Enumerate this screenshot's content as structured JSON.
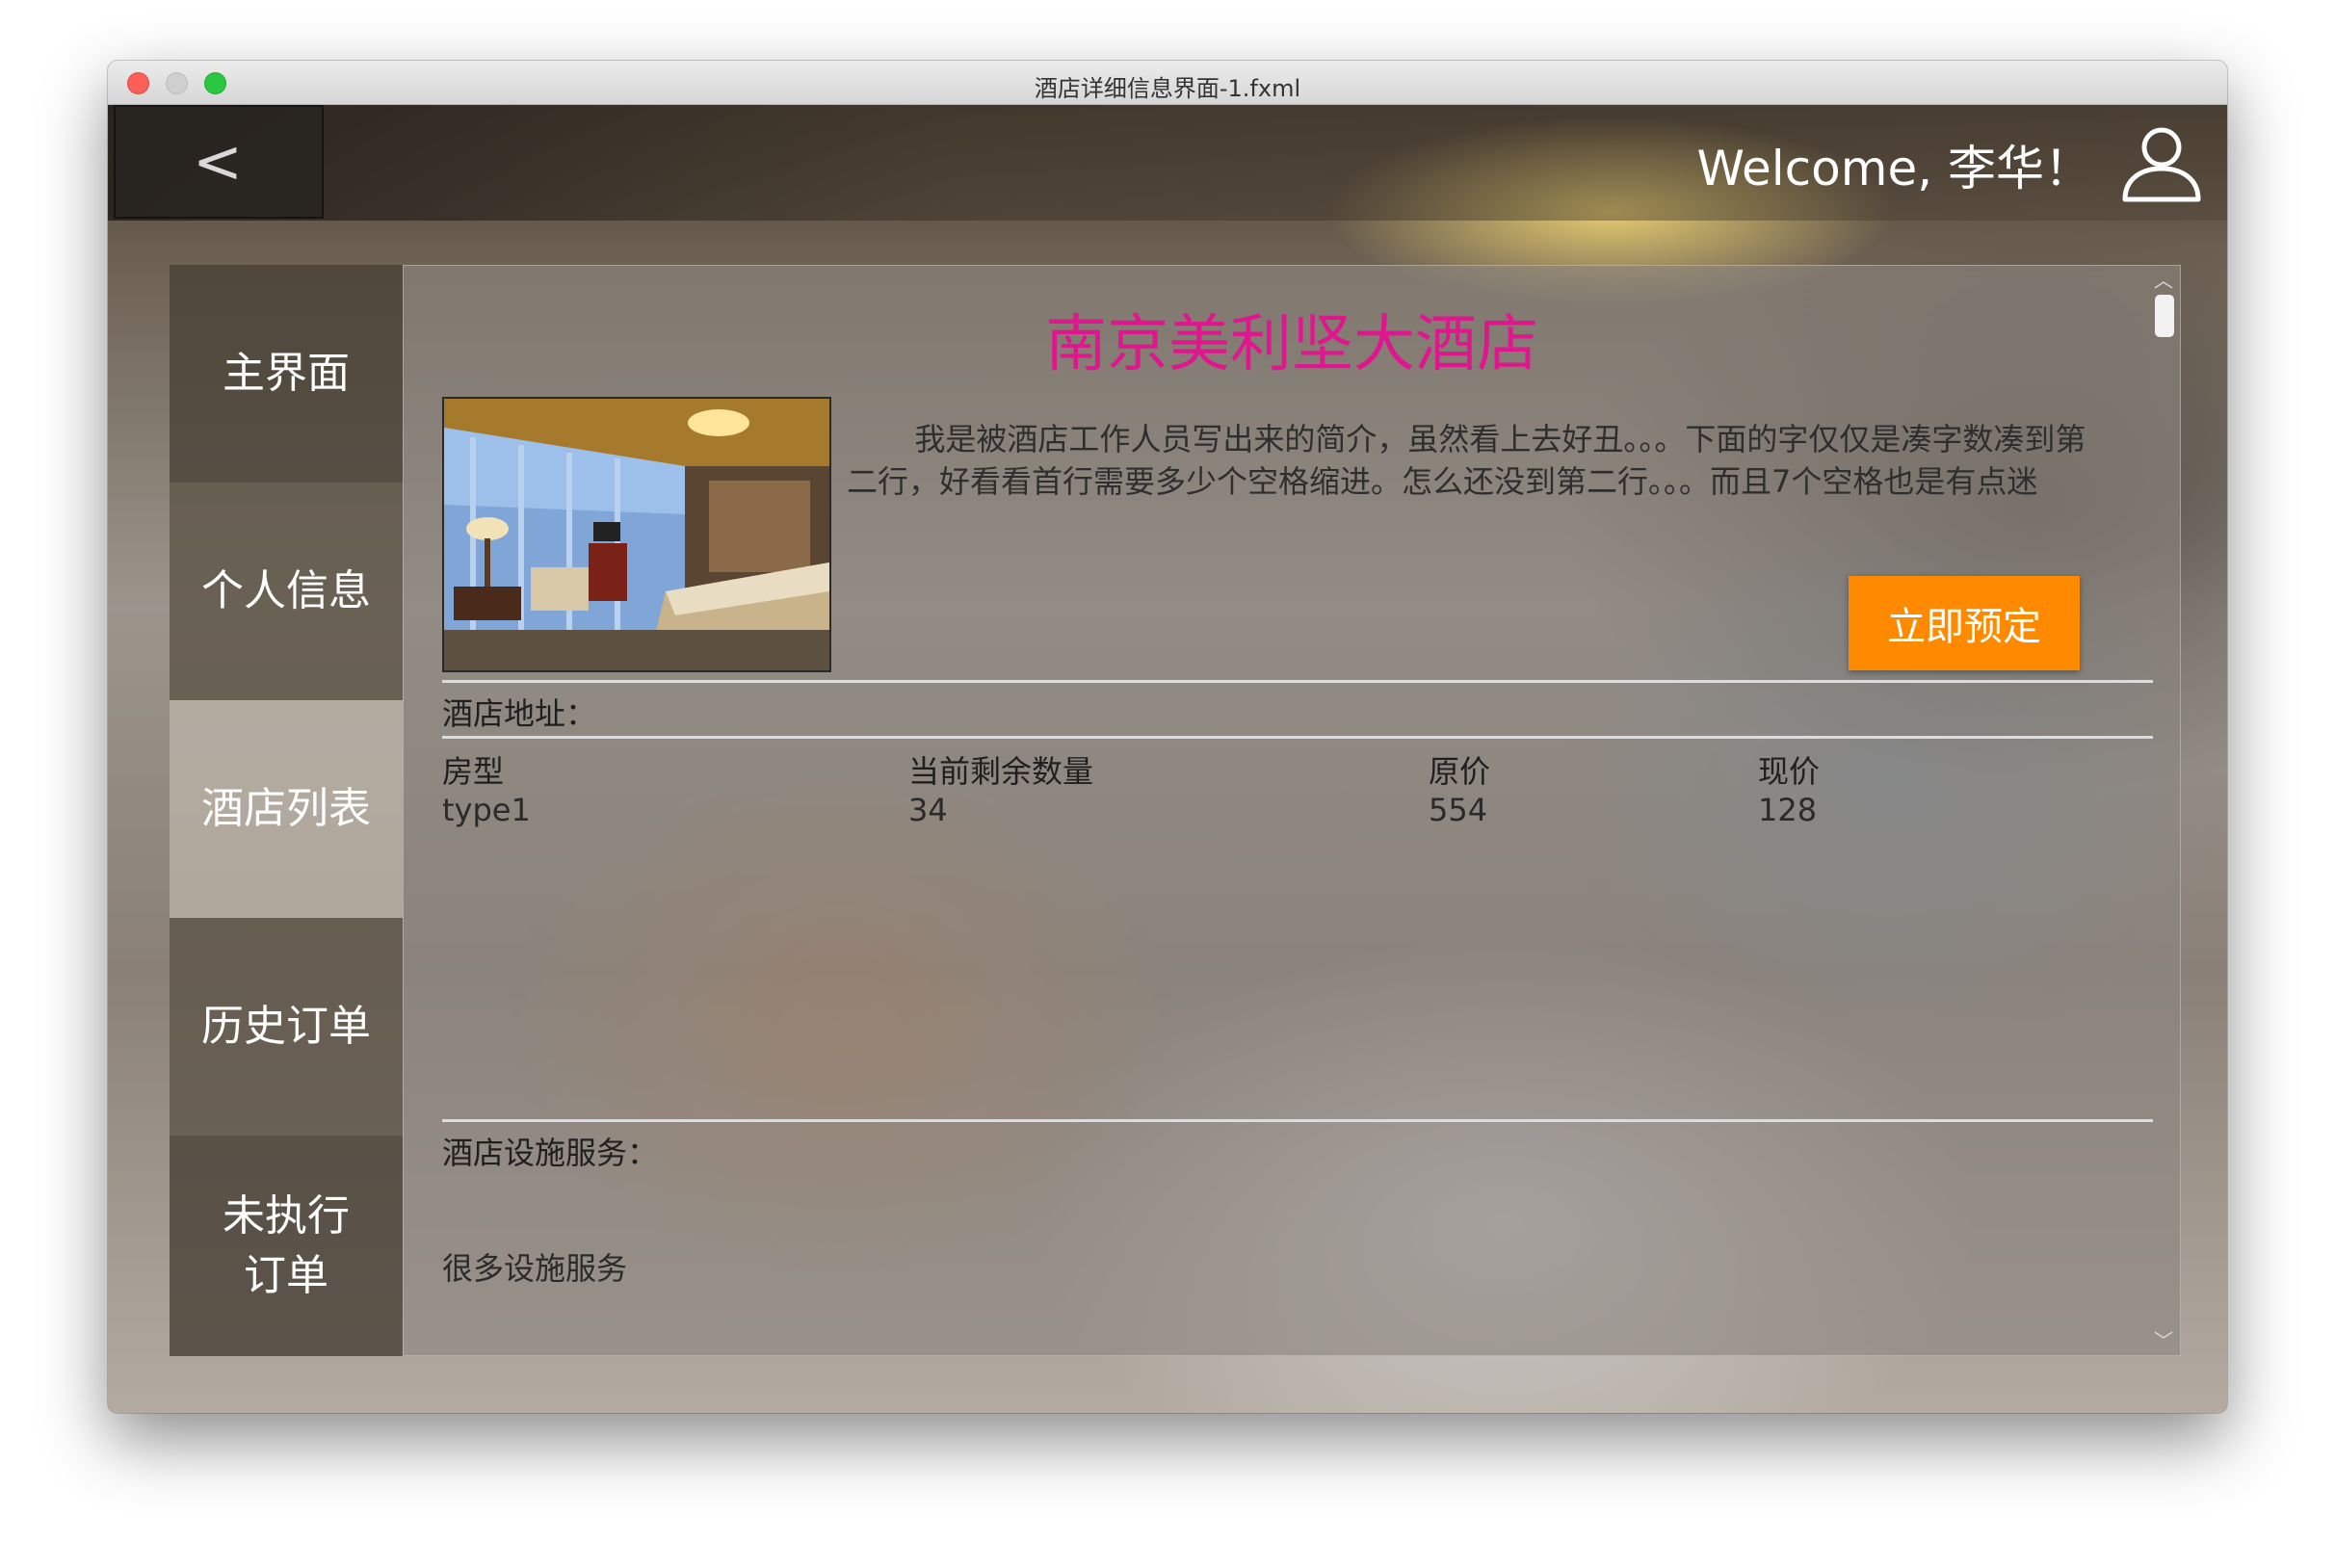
{
  "window": {
    "title": "酒店详细信息界面-1.fxml"
  },
  "topbar": {
    "back_label": "<",
    "welcome": "Welcome, 李华！",
    "user_icon": "user-icon"
  },
  "sidebar": {
    "items": [
      {
        "label": "主界面"
      },
      {
        "label": "个人信息"
      },
      {
        "label": "酒店列表",
        "active": true
      },
      {
        "label": "历史订单"
      },
      {
        "label": "未执行\n订单"
      }
    ]
  },
  "hotel": {
    "name": "南京美利坚大酒店",
    "intro": "我是被酒店工作人员写出来的简介，虽然看上去好丑。。。下面的字仅仅是凑字数凑到第二行，好看看首行需要多少个空格缩进。怎么还没到第二行。。。而且7个空格也是有点迷",
    "book_button": "立即预定",
    "address_label": "酒店地址：",
    "facilities_label": "酒店设施服务：",
    "facilities_text": "很多设施服务"
  },
  "rooms": {
    "headers": [
      "房型",
      "当前剩余数量",
      "原价",
      "现价"
    ],
    "rows": [
      [
        "type1",
        "34",
        "554",
        "128"
      ]
    ]
  },
  "colors": {
    "hotel_name": "#e0168f",
    "book_button": "#ff8a00"
  }
}
